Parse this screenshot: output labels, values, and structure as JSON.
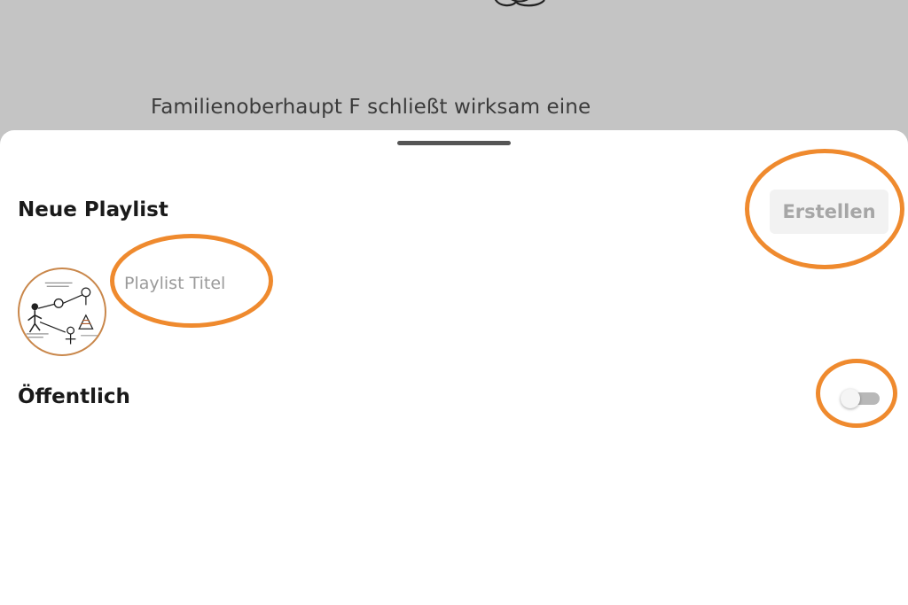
{
  "backdrop": {
    "text": "Familienoberhaupt F schließt wirksam eine"
  },
  "sheet": {
    "title": "Neue Playlist",
    "create_button_label": "Erstellen",
    "title_input": {
      "placeholder": "Playlist Titel",
      "value": ""
    },
    "cover_image_icon": "playlist-cover-image",
    "public_label": "Öffentlich",
    "public_toggle_on": false
  },
  "colors": {
    "highlight": "#ef8a2e",
    "backdrop": "#c4c4c4",
    "cover_border": "#c9874b"
  }
}
